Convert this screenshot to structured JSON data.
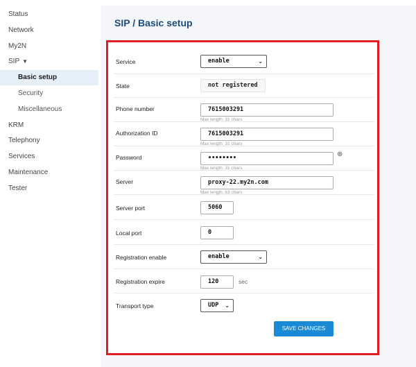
{
  "sidebar": {
    "items": [
      {
        "label": "Status"
      },
      {
        "label": "Network"
      },
      {
        "label": "My2N"
      },
      {
        "label": "SIP",
        "caret": "▼"
      },
      {
        "label": "Basic setup"
      },
      {
        "label": "Security"
      },
      {
        "label": "Miscellaneous"
      },
      {
        "label": "KRM"
      },
      {
        "label": "Telephony"
      },
      {
        "label": "Services"
      },
      {
        "label": "Maintenance"
      },
      {
        "label": "Tester"
      }
    ]
  },
  "page": {
    "title": "SIP / Basic setup"
  },
  "form": {
    "service": {
      "label": "Service",
      "value": "enable"
    },
    "state": {
      "label": "State",
      "value": "not registered"
    },
    "phone_number": {
      "label": "Phone number",
      "value": "7615003291",
      "hint": "Max length:  31 chars"
    },
    "authorization_id": {
      "label": "Authorization ID",
      "value": "7615003291",
      "hint": "Max length:  31 chars"
    },
    "password": {
      "label": "Password",
      "value": "••••••••",
      "hint": "Max length:  31 chars"
    },
    "server": {
      "label": "Server",
      "value": "proxy-22.my2n.com",
      "hint": "Max length:  63 chars"
    },
    "server_port": {
      "label": "Server port",
      "value": "5060"
    },
    "local_port": {
      "label": "Local port",
      "value": "0"
    },
    "registration_enable": {
      "label": "Registration enable",
      "value": "enable"
    },
    "registration_expire": {
      "label": "Registration expire",
      "value": "120",
      "unit": "sec"
    },
    "transport_type": {
      "label": "Transport type",
      "value": "UDP"
    },
    "save_label": "SAVE CHANGES"
  },
  "icons": {
    "chevron": "⌄",
    "eye": "⊕"
  },
  "colors": {
    "accent": "#1a8ad6",
    "title": "#1a4c7d",
    "highlight_frame": "#e31b23"
  }
}
